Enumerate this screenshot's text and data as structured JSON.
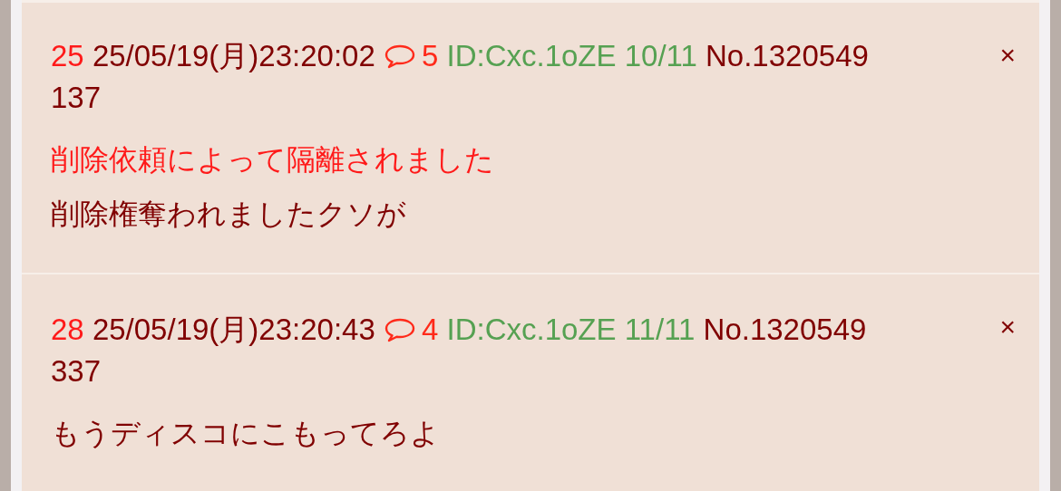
{
  "posts": [
    {
      "number": "25",
      "date": "25/05/19(月)23:20:02",
      "replies": "5",
      "id": "ID:Cxc.1oZE",
      "id_count": "10/11",
      "no_lines": [
        "No.1320549",
        "137"
      ],
      "close": "×",
      "lines": [
        {
          "kind": "notice",
          "text": "削除依頼によって隔離されました"
        },
        {
          "kind": "body",
          "text": "削除権奪われましたクソが"
        }
      ]
    },
    {
      "number": "28",
      "date": "25/05/19(月)23:20:43",
      "replies": "4",
      "id": "ID:Cxc.1oZE",
      "id_count": "11/11",
      "no_lines": [
        "No.1320549",
        "337"
      ],
      "close": "×",
      "lines": [
        {
          "kind": "body",
          "text": "もうディスコにこもってろよ"
        }
      ]
    }
  ]
}
